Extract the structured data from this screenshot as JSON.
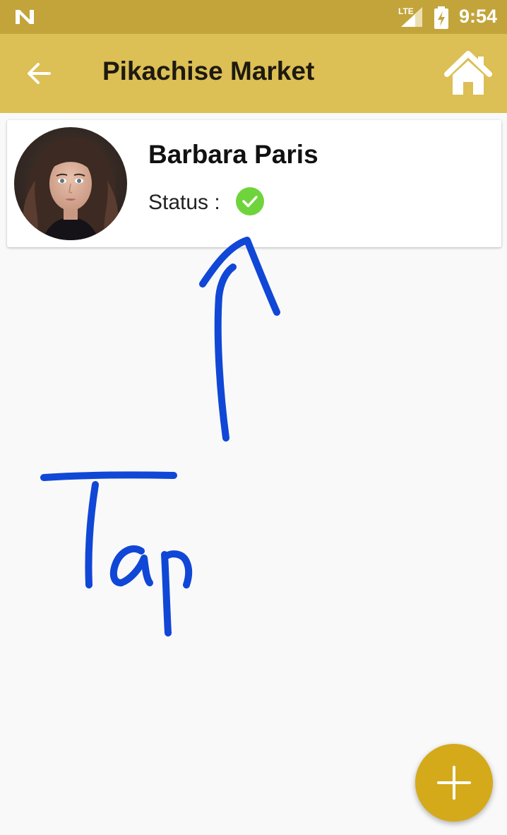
{
  "status_bar": {
    "network_label": "LTE",
    "time": "9:54",
    "icons": [
      "notification-n-icon",
      "lte-signal-icon",
      "battery-charging-icon"
    ]
  },
  "app_bar": {
    "title": "Pikachise Market",
    "back_icon": "arrow-left-icon",
    "home_icon": "home-icon",
    "colors": {
      "app_bar": "#dcbf55",
      "status_bar": "#c2a43b"
    }
  },
  "contact_card": {
    "name": "Barbara Paris",
    "status_label": "Status :",
    "status_icon": "check-circle-icon",
    "status_color": "#6fd43b"
  },
  "annotation": {
    "text": "Tap",
    "color": "#1047d6"
  },
  "fab": {
    "icon": "plus-icon",
    "color": "#d4aa1b"
  }
}
